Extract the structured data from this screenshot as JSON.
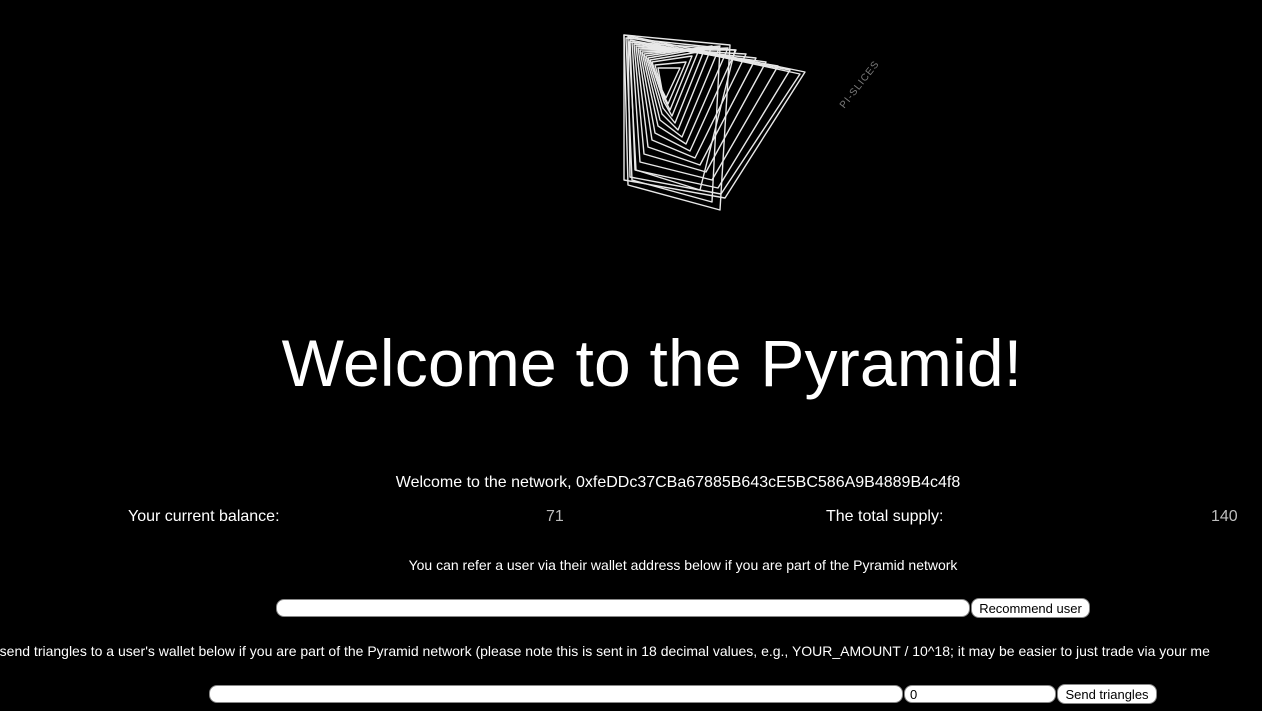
{
  "logo": {
    "icon": "pyramid-slices-icon",
    "caption": "PI-SLICES"
  },
  "title": "Welcome to the Pyramid!",
  "welcome": {
    "text": "Welcome to the network, 0xfeDDc37CBa67885B643cE5BC586A9B4889B4c4f8"
  },
  "stats": {
    "balance_label": "Your current balance:",
    "balance_value": "71",
    "supply_label": "The total supply:",
    "supply_value": "140"
  },
  "refer": {
    "description": "You can refer a user via their wallet address below if you are part of the Pyramid network",
    "input_value": "",
    "button_label": "Recommend user"
  },
  "send": {
    "description": "n send triangles to a user's wallet below if you are part of the Pyramid network (please note this is sent in 18 decimal values, e.g., YOUR_AMOUNT / 10^18; it may be easier to just trade via your me",
    "address_value": "",
    "amount_value": "0",
    "button_label": "Send triangles"
  }
}
